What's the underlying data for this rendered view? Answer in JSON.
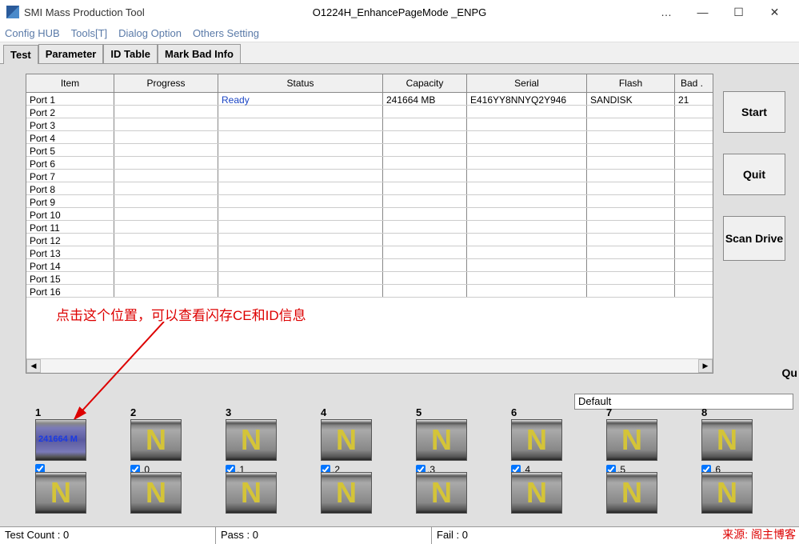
{
  "window": {
    "title": "SMI Mass Production Tool",
    "center_text": "O1224H_EnhancePageMode    _ENPG"
  },
  "menu": {
    "items": [
      "Config HUB",
      "Tools[T]",
      "Dialog Option",
      "Others Setting"
    ]
  },
  "tabs": {
    "items": [
      "Test",
      "Parameter",
      "ID Table",
      "Mark Bad Info"
    ],
    "active": 0
  },
  "table": {
    "headers": [
      "Item",
      "Progress",
      "Status",
      "Capacity",
      "Serial",
      "Flash",
      "Bad ."
    ],
    "rows": [
      {
        "item": "Port 1",
        "progress": "",
        "status": "Ready",
        "capacity": "241664 MB",
        "serial": "E416YY8NNYQ2Y946",
        "flash": "SANDISK",
        "bad": "21"
      },
      {
        "item": "Port 2"
      },
      {
        "item": "Port 3"
      },
      {
        "item": "Port 4"
      },
      {
        "item": "Port 5"
      },
      {
        "item": "Port 6"
      },
      {
        "item": "Port 7"
      },
      {
        "item": "Port 8"
      },
      {
        "item": "Port 9"
      },
      {
        "item": "Port 10"
      },
      {
        "item": "Port 11"
      },
      {
        "item": "Port 12"
      },
      {
        "item": "Port 13"
      },
      {
        "item": "Port 14"
      },
      {
        "item": "Port 15"
      },
      {
        "item": "Port 16"
      }
    ]
  },
  "annotation": {
    "text": "点击这个位置，可以查看闪存CE和ID信息"
  },
  "buttons": {
    "start": "Start",
    "quit": "Quit",
    "scan": "Scan Drive"
  },
  "qu_label": "Qu",
  "default_box": "Default",
  "slots_row1": [
    {
      "num": "1",
      "type": "detected",
      "cap": "241664 M",
      "checked": true,
      "chk_label": ""
    },
    {
      "num": "2",
      "type": "N",
      "checked": true,
      "chk_label": ".0"
    },
    {
      "num": "3",
      "type": "N",
      "checked": true,
      "chk_label": ".1"
    },
    {
      "num": "4",
      "type": "N",
      "checked": true,
      "chk_label": ".2"
    },
    {
      "num": "5",
      "type": "N",
      "checked": true,
      "chk_label": ".3"
    },
    {
      "num": "6",
      "type": "N",
      "checked": true,
      "chk_label": ".4"
    },
    {
      "num": "7",
      "type": "N",
      "checked": true,
      "chk_label": ".5"
    },
    {
      "num": "8",
      "type": "N",
      "checked": true,
      "chk_label": ".6"
    }
  ],
  "slots_row2": [
    {
      "type": "N"
    },
    {
      "type": "N"
    },
    {
      "type": "N"
    },
    {
      "type": "N"
    },
    {
      "type": "N"
    },
    {
      "type": "N"
    },
    {
      "type": "N"
    },
    {
      "type": "N"
    }
  ],
  "status": {
    "test_count": "Test Count : 0",
    "pass": "Pass : 0",
    "fail": "Fail : 0"
  },
  "watermark": "来源: 阁主博客"
}
